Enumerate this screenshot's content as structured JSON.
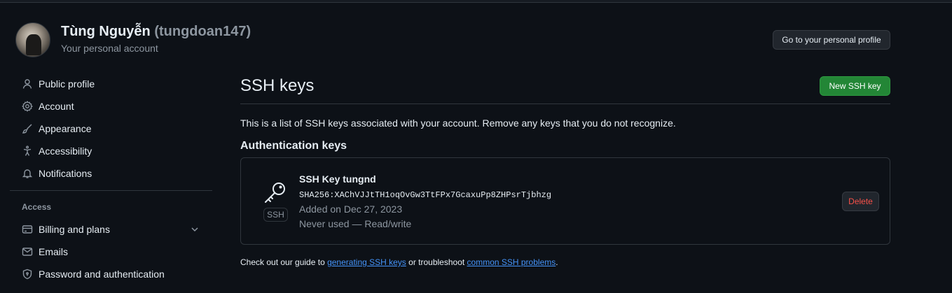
{
  "header": {
    "display_name": "Tùng Nguyễn",
    "username": "(tungdoan147)",
    "subtitle": "Your personal account",
    "profile_button": "Go to your personal profile"
  },
  "sidebar": {
    "items": [
      {
        "label": "Public profile",
        "icon": "person-icon"
      },
      {
        "label": "Account",
        "icon": "gear-icon"
      },
      {
        "label": "Appearance",
        "icon": "paintbrush-icon"
      },
      {
        "label": "Accessibility",
        "icon": "accessibility-icon"
      },
      {
        "label": "Notifications",
        "icon": "bell-icon"
      }
    ],
    "access_label": "Access",
    "access_items": [
      {
        "label": "Billing and plans",
        "icon": "credit-card-icon"
      },
      {
        "label": "Emails",
        "icon": "mail-icon"
      },
      {
        "label": "Password and authentication",
        "icon": "shield-lock-icon"
      }
    ]
  },
  "main": {
    "title": "SSH keys",
    "new_key_button": "New SSH key",
    "description": "This is a list of SSH keys associated with your account. Remove any keys that you do not recognize.",
    "auth_heading": "Authentication keys",
    "key": {
      "title": "SSH Key tungnd",
      "fingerprint": "SHA256:XAChVJJtTH1oqOvGw3TtFPx7GcaxuPp8ZHPsrTjbhzg",
      "added": "Added on Dec 27, 2023",
      "usage": "Never used — Read/write",
      "badge": "SSH",
      "delete_button": "Delete"
    },
    "footer": {
      "prefix": "Check out our guide to ",
      "link1": "generating SSH keys",
      "middle": " or troubleshoot ",
      "link2": "common SSH problems",
      "suffix": "."
    }
  },
  "colors": {
    "background": "#0d1117",
    "primary_button": "#238636",
    "link": "#4493f8",
    "danger": "#f85149",
    "muted_text": "#8d96a0"
  }
}
